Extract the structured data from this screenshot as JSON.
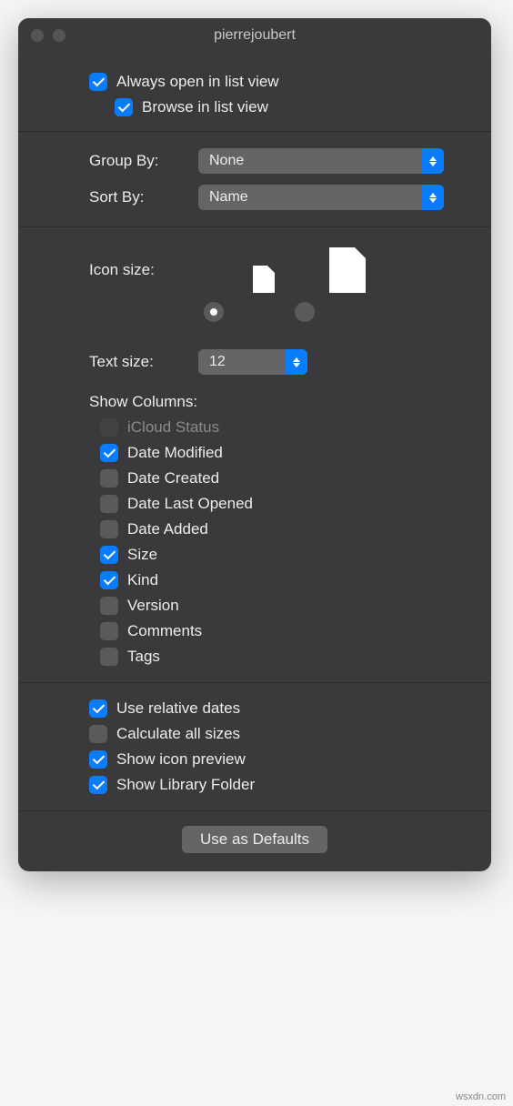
{
  "window": {
    "title": "pierrejoubert"
  },
  "top": {
    "always_open_label": "Always open in list view",
    "always_open_checked": true,
    "browse_label": "Browse in list view",
    "browse_checked": true
  },
  "group_sort": {
    "group_label": "Group By:",
    "group_value": "None",
    "sort_label": "Sort By:",
    "sort_value": "Name"
  },
  "icon_size": {
    "label": "Icon size:",
    "selected": "small"
  },
  "text_size": {
    "label": "Text size:",
    "value": "12"
  },
  "columns": {
    "heading": "Show Columns:",
    "items": [
      {
        "label": "iCloud Status",
        "checked": false,
        "disabled": true
      },
      {
        "label": "Date Modified",
        "checked": true,
        "disabled": false
      },
      {
        "label": "Date Created",
        "checked": false,
        "disabled": false
      },
      {
        "label": "Date Last Opened",
        "checked": false,
        "disabled": false
      },
      {
        "label": "Date Added",
        "checked": false,
        "disabled": false
      },
      {
        "label": "Size",
        "checked": true,
        "disabled": false
      },
      {
        "label": "Kind",
        "checked": true,
        "disabled": false
      },
      {
        "label": "Version",
        "checked": false,
        "disabled": false
      },
      {
        "label": "Comments",
        "checked": false,
        "disabled": false
      },
      {
        "label": "Tags",
        "checked": false,
        "disabled": false
      }
    ]
  },
  "options": {
    "items": [
      {
        "label": "Use relative dates",
        "checked": true
      },
      {
        "label": "Calculate all sizes",
        "checked": false
      },
      {
        "label": "Show icon preview",
        "checked": true
      },
      {
        "label": "Show Library Folder",
        "checked": true
      }
    ]
  },
  "footer": {
    "defaults_button": "Use as Defaults"
  },
  "watermark": "wsxdn.com"
}
